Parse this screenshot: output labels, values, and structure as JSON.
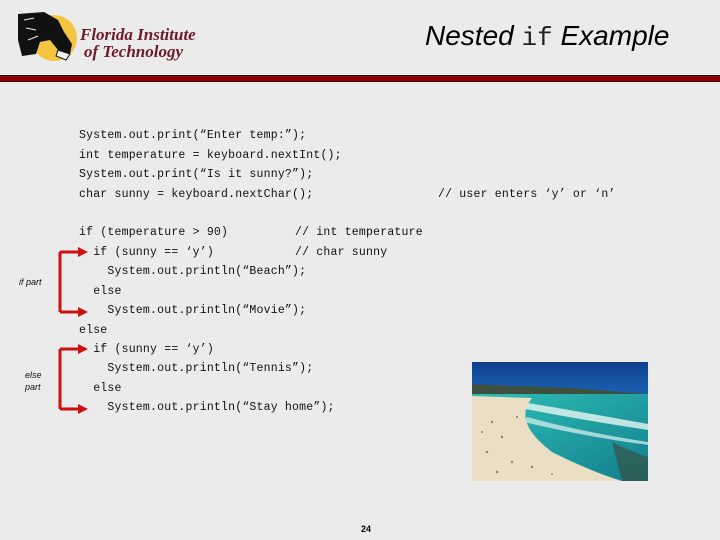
{
  "logo": {
    "line1": "Florida Institute",
    "line2": "of Technology"
  },
  "title": {
    "before": "Nested ",
    "code": "if",
    "after": " Example"
  },
  "code_lines": [
    "System.out.print(“Enter temp:”);",
    "int temperature = keyboard.nextInt();",
    "System.out.print(“Is it sunny?”);",
    "char sunny = keyboard.nextChar();",
    "if (temperature > 90)",
    "  if (sunny == ‘y’)",
    "    System.out.println(“Beach”);",
    "  else",
    "    System.out.println(“Movie”);",
    "else",
    "  if (sunny == ‘y’)",
    "    System.out.println(“Tennis”);",
    "  else",
    "    System.out.println(“Stay home”);"
  ],
  "comments": {
    "user_enters": "// user enters ‘y’ or ‘n’",
    "int_temperature": "// int temperature",
    "char_sunny": "// char sunny"
  },
  "labels": {
    "if_part": "if part",
    "else_part_1": "else",
    "else_part_2": "part"
  },
  "image": {
    "description": "beach-photo"
  },
  "page_number": "24",
  "colors": {
    "accent": "#8b0000",
    "arrow": "#cc1111",
    "logo_text": "#6e1a2a"
  }
}
